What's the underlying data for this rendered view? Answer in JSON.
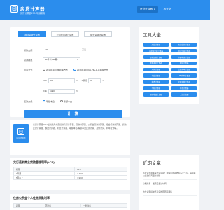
{
  "header": {
    "site_name": "房贷计算器",
    "site_sub": "房贷计算器2024年最新版",
    "nav": [
      {
        "label": "房贷计算器",
        "active": true
      },
      {
        "label": "工具大全",
        "active": false
      }
    ]
  },
  "calculator": {
    "tabs": [
      "商业贷款计算器",
      "公积金贷款计算器",
      "组合贷款计算器"
    ],
    "fields": {
      "amount_label": "贷款金额",
      "amount_value": "100",
      "amount_unit": "万元",
      "term_label": "贷款期限",
      "term_value": "30年（360期）",
      "rate_label": "利率方式",
      "rate_options": [
        "2019年10月前利率方式",
        "2019年10月后LPR+基点利率方式"
      ],
      "lpr_label": "LPR",
      "lpr_value": "4.2",
      "lpr_unit": "%",
      "bp_label": "+基点",
      "bp_value": "0",
      "bp_unit": "%",
      "rate_value_label": "利率",
      "rate_value": "4.90",
      "rate_unit": "%",
      "repay_label": "还款方式",
      "repay_options": [
        "等额本息",
        "等额本金"
      ]
    },
    "submit_label": "计 算"
  },
  "intro": {
    "icon_label": "房贷计算器",
    "text": "房贷计算器2024最新版为大家提供房贷计算器、贷款计算器、公积金贷款计算器、组合贷款计算器、提前还款计算器、税费计算器、利息计算器、等额本息/等额本金还款计算、月供计算、利率查询等。"
  },
  "rates": {
    "title": "央行最新商业贷款基准利率(LPR)",
    "columns": [
      "期限",
      "LPR"
    ],
    "rows": [
      [
        "1年期",
        "3.45%"
      ],
      [
        "5年以上",
        "3.95%"
      ]
    ]
  },
  "fund_rates": {
    "title": "住房公积金个人住房贷款利率",
    "columns": [
      "期限",
      "首套房",
      "二套住房"
    ]
  },
  "sidebar": {
    "tools_title": "工具大全",
    "tools": [
      "房贷计算器",
      "商业贷款计算器",
      "公积金贷款计算器",
      "组合贷款计算器",
      "提前还款计算器",
      "等额本息计算器",
      "等额本金计算器",
      "利息计算器",
      "月供计算器",
      "贷款利率计算器",
      "车贷计算器",
      "LPR利率计算器",
      "税费计算器",
      "房屋契税计算器",
      "个税计算器",
      "存款计算器",
      "理财收益计算器",
      "工资计算器"
    ],
    "news_title": "近期文章",
    "news": [
      "商业贷款利率是什么意思？申请贷款需要有多少个人，请留着以后我们再更新谢谢",
      "分期房贷一般需要多长时间？",
      "为什么要提前还房贷的原因有哪些"
    ]
  },
  "colors": {
    "accent": "#2b8ded",
    "background": "#f0f2f5"
  }
}
